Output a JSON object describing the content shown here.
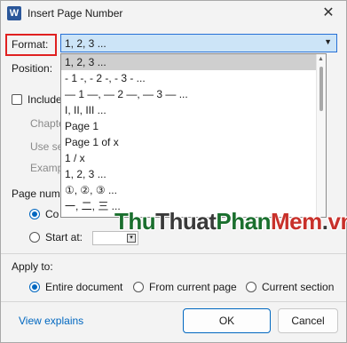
{
  "window": {
    "app_icon": "W",
    "title": "Insert Page Number",
    "close_glyph": "✕"
  },
  "format": {
    "label": "Format:",
    "selected": "1, 2, 3 ...",
    "options": [
      "1, 2, 3 ...",
      "- 1 -, - 2 -, - 3 - ...",
      "— 1 —, — 2 —, — 3 — ...",
      "I, II, III ...",
      "Page 1",
      "Page 1 of x",
      "1 / x",
      "1, 2, 3 ...",
      "①, ②, ③ ...",
      "一, 二, 三 ..."
    ]
  },
  "position": {
    "label": "Position:"
  },
  "include_chapter": {
    "label": "Include"
  },
  "chapter_fields": {
    "chapter_starts": "Chapte",
    "use_separator": "Use se",
    "examples": "Examp"
  },
  "page_numbering": {
    "label": "Page num",
    "continue_label": "Co",
    "start_at_label": "Start at:"
  },
  "apply_to": {
    "label": "Apply to:",
    "options": [
      "Entire document",
      "From current page",
      "Current section"
    ],
    "selected_index": 0
  },
  "footer": {
    "link": "View explains",
    "ok": "OK",
    "cancel": "Cancel"
  },
  "watermark": {
    "part1": "Thu",
    "part2": "Thuat",
    "part3": "Phan",
    "part4": "Mem",
    "part5": ".",
    "part6": "vn"
  },
  "colors": {
    "accent": "#0067c0",
    "highlight_border": "#e02020",
    "combo_fill": "#cce4f7"
  }
}
